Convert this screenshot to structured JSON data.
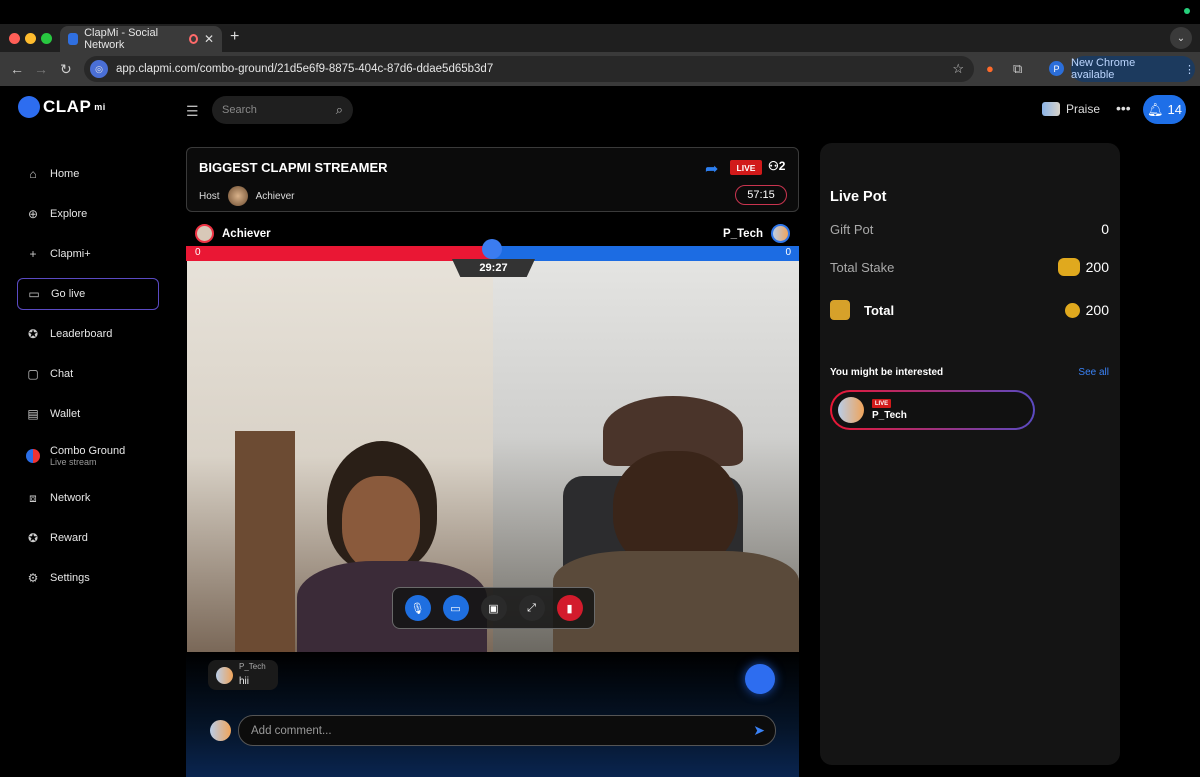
{
  "browser": {
    "tab_title": "ClapMi - Social Network",
    "url": "app.clapmi.com/combo-ground/21d5e6f9-8875-404c-87d6-ddae5d65b3d7",
    "new_chrome": "New Chrome available",
    "profile_initial": "P"
  },
  "header": {
    "logo_text": "CLAP",
    "logo_sup": "mi",
    "search_placeholder": "Search",
    "user_name": "Praise",
    "notifications": "14"
  },
  "sidebar": {
    "items": [
      {
        "label": "Home",
        "icon": "home-icon"
      },
      {
        "label": "Explore",
        "icon": "explore-icon"
      },
      {
        "label": "Clapmi+",
        "icon": "plus-icon"
      },
      {
        "label": "Go live",
        "icon": "camera-icon"
      },
      {
        "label": "Leaderboard",
        "icon": "award-icon"
      },
      {
        "label": "Chat",
        "icon": "chat-icon"
      },
      {
        "label": "Wallet",
        "icon": "wallet-icon"
      },
      {
        "label": "Combo Ground",
        "sub": "Live stream",
        "icon": "combo-icon"
      },
      {
        "label": "Network",
        "icon": "network-icon"
      },
      {
        "label": "Reward",
        "icon": "reward-icon"
      },
      {
        "label": "Settings",
        "icon": "settings-icon"
      }
    ]
  },
  "stream": {
    "title": "BIGGEST CLAPMI STREAMER",
    "host_label": "Host",
    "host_name": "Achiever",
    "live_label": "LIVE",
    "viewers": "2",
    "timer": "57:15",
    "left_player": "Achiever",
    "right_player": "P_Tech",
    "left_score": "0",
    "right_score": "0",
    "battle_timer": "29:27"
  },
  "chat": {
    "messages": [
      {
        "user": "P_Tech",
        "text": "hii"
      }
    ],
    "comment_placeholder": "Add comment..."
  },
  "pot": {
    "title": "Live Pot",
    "gift_label": "Gift Pot",
    "gift_value": "0",
    "stake_label": "Total Stake",
    "stake_value": "200",
    "total_label": "Total",
    "total_value": "200",
    "interest_label": "You might be interested",
    "see_all": "See all",
    "suggest_live": "LIVE",
    "suggest_name": "P_Tech"
  },
  "colors": {
    "accent_blue": "#1f6fe0",
    "live_red": "#d11a1a",
    "score_red": "#ea1734",
    "score_blue": "#1c6ce3",
    "coin_gold": "#e0a91e"
  }
}
